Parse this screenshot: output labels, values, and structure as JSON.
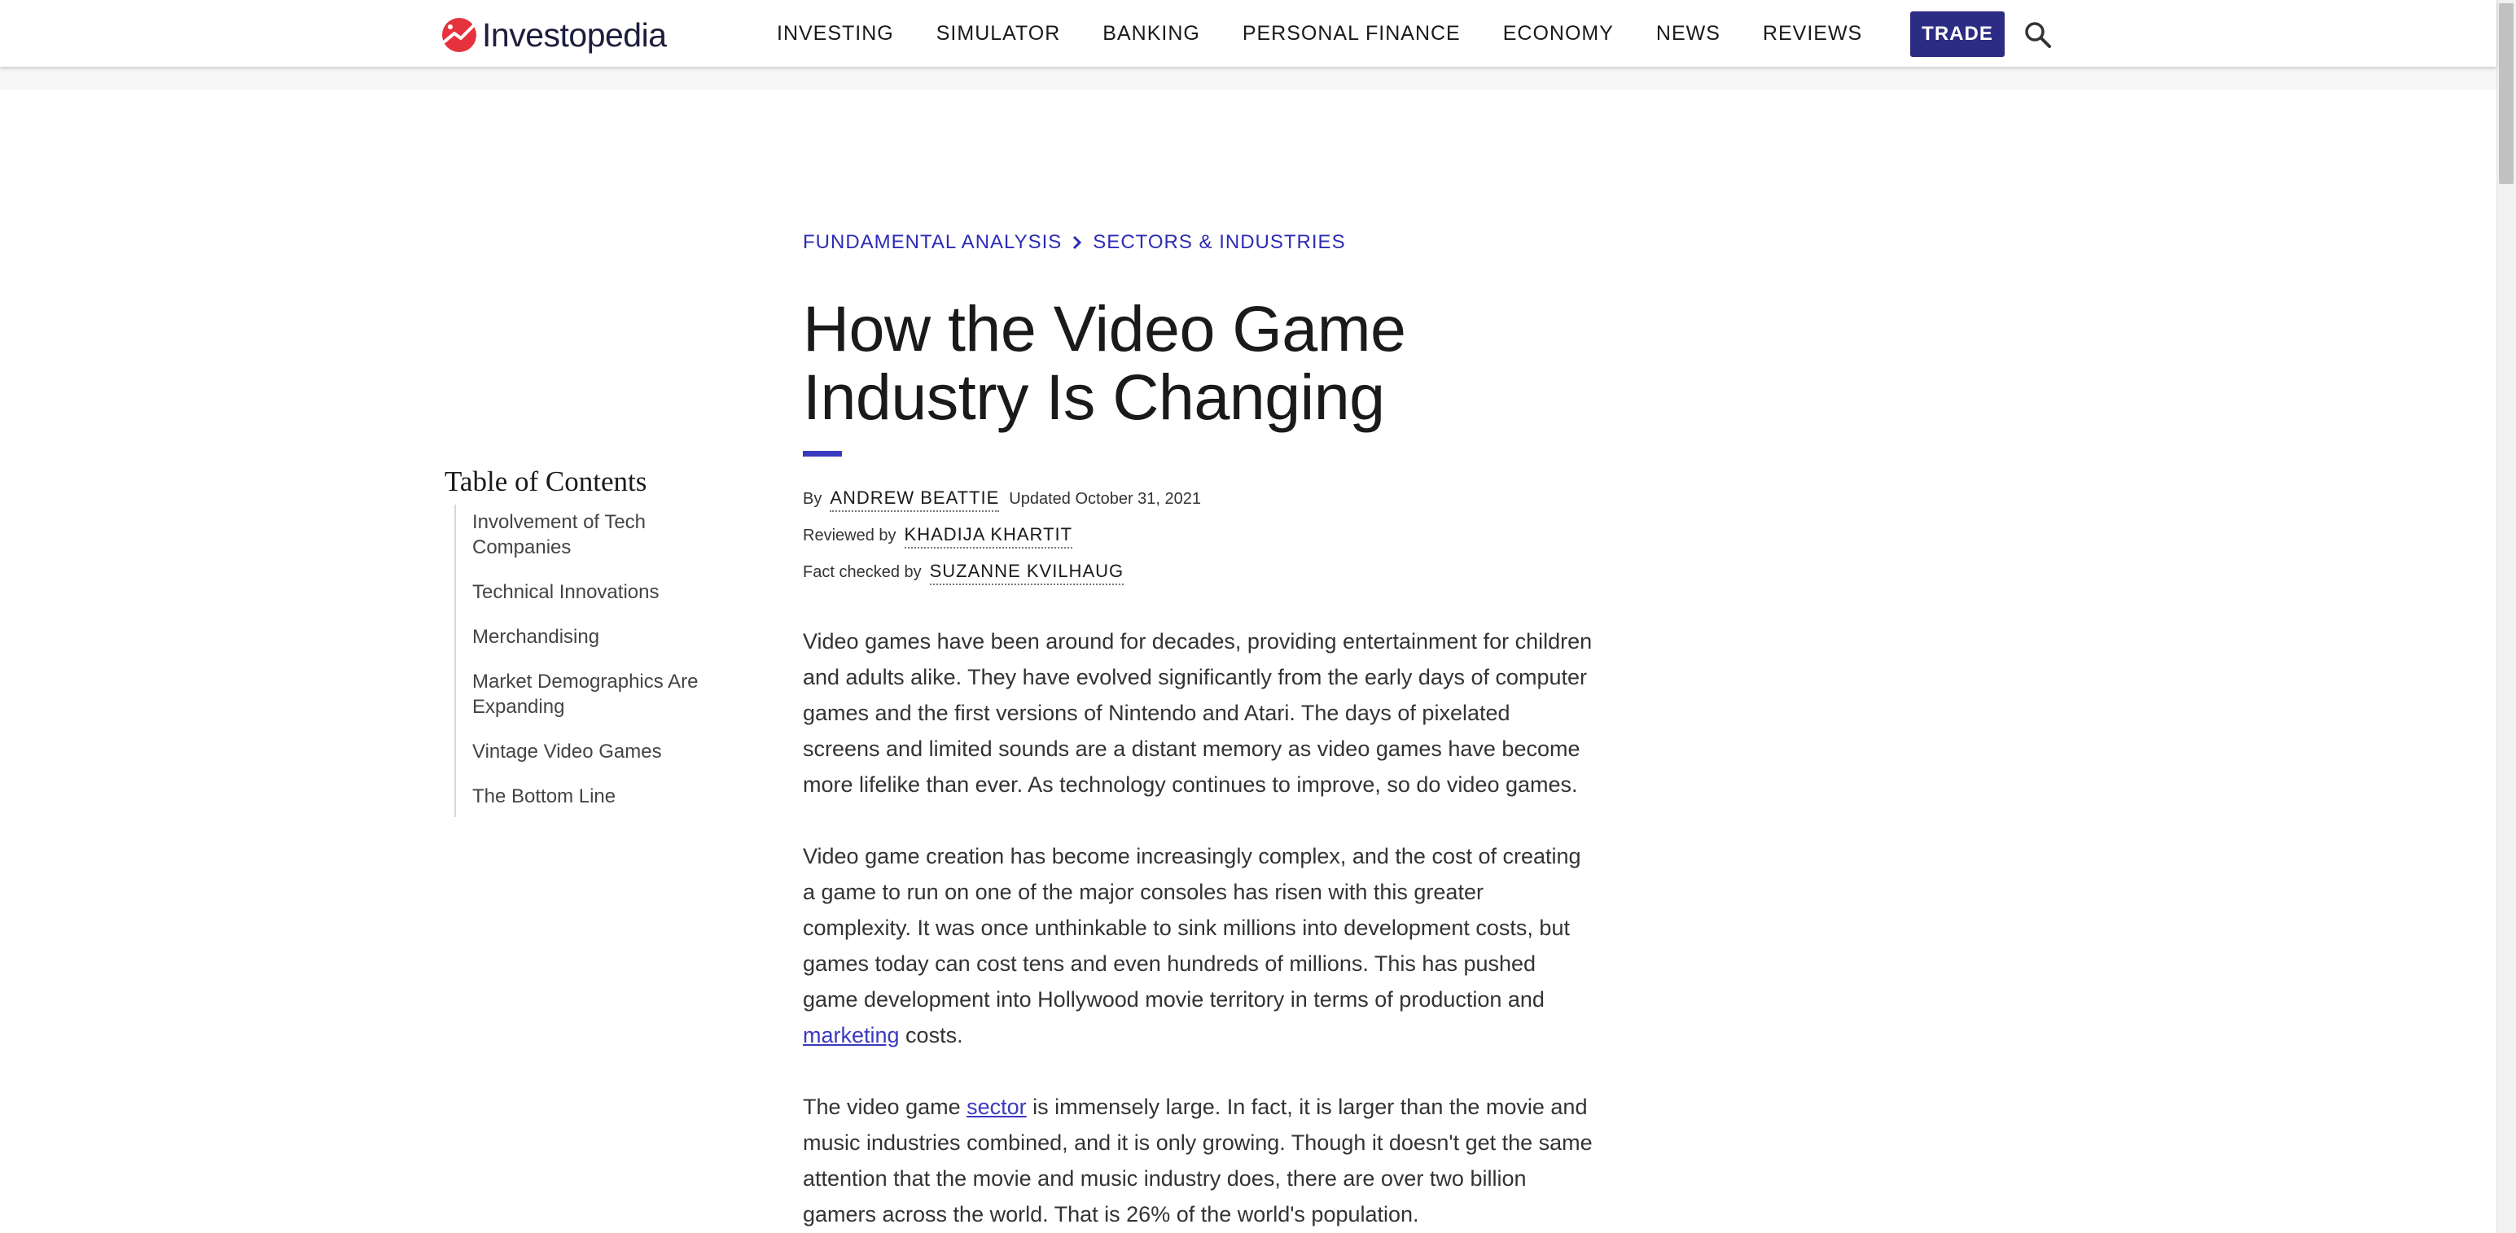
{
  "header": {
    "logo_text": "Investopedia",
    "nav": [
      "INVESTING",
      "SIMULATOR",
      "BANKING",
      "PERSONAL FINANCE",
      "ECONOMY",
      "NEWS",
      "REVIEWS"
    ],
    "trade_label": "TRADE"
  },
  "breadcrumb": {
    "first": "FUNDAMENTAL ANALYSIS",
    "second": "SECTORS & INDUSTRIES"
  },
  "article": {
    "title": "How the Video Game Industry Is Changing",
    "byline": {
      "by_prefix": "By",
      "author": "ANDREW BEATTIE",
      "updated": "Updated October 31, 2021",
      "reviewed_prefix": "Reviewed by",
      "reviewer": "KHADIJA KHARTIT",
      "fact_prefix": "Fact checked by",
      "fact_checker": "SUZANNE KVILHAUG"
    },
    "paragraph1": "Video games have been around for decades, providing entertainment for children and adults alike. They have evolved significantly from the early days of computer games and the first versions of Nintendo and Atari. The days of pixelated screens and limited sounds are a distant memory as video games have become more lifelike than ever. As technology continues to improve, so do video games.",
    "paragraph2": {
      "before": "Video game creation has become increasingly complex, and the cost of creating a game to run on one of the major consoles has risen with this greater complexity. It was once unthinkable to sink millions into development costs, but games today can cost tens and even hundreds of millions. This has pushed game development into Hollywood movie territory in terms of production and ",
      "link": "marketing",
      "after": " costs."
    },
    "paragraph3": {
      "before": "The video game ",
      "link": "sector",
      "after": " is immensely large. In fact, it is larger than the movie and music industries combined, and it is only growing. Though it doesn't get the same attention that the movie and music industry does, there are over two billion gamers across the world. That is 26% of the world's population."
    }
  },
  "toc": {
    "title": "Table of Contents",
    "items": [
      "Involvement of Tech Companies",
      "Technical Innovations",
      "Merchandising",
      "Market Demographics Are Expanding",
      "Vintage Video Games",
      "The Bottom Line"
    ]
  },
  "colors": {
    "accent": "#3a3ac0",
    "trade_button": "#2c2c84",
    "logo_red": "#e6323e",
    "logo_navy": "#1d1d3b"
  },
  "icons": {
    "logo": "investopedia-logo-icon",
    "breadcrumb_separator": "chevron-right-icon",
    "search": "search-icon"
  }
}
